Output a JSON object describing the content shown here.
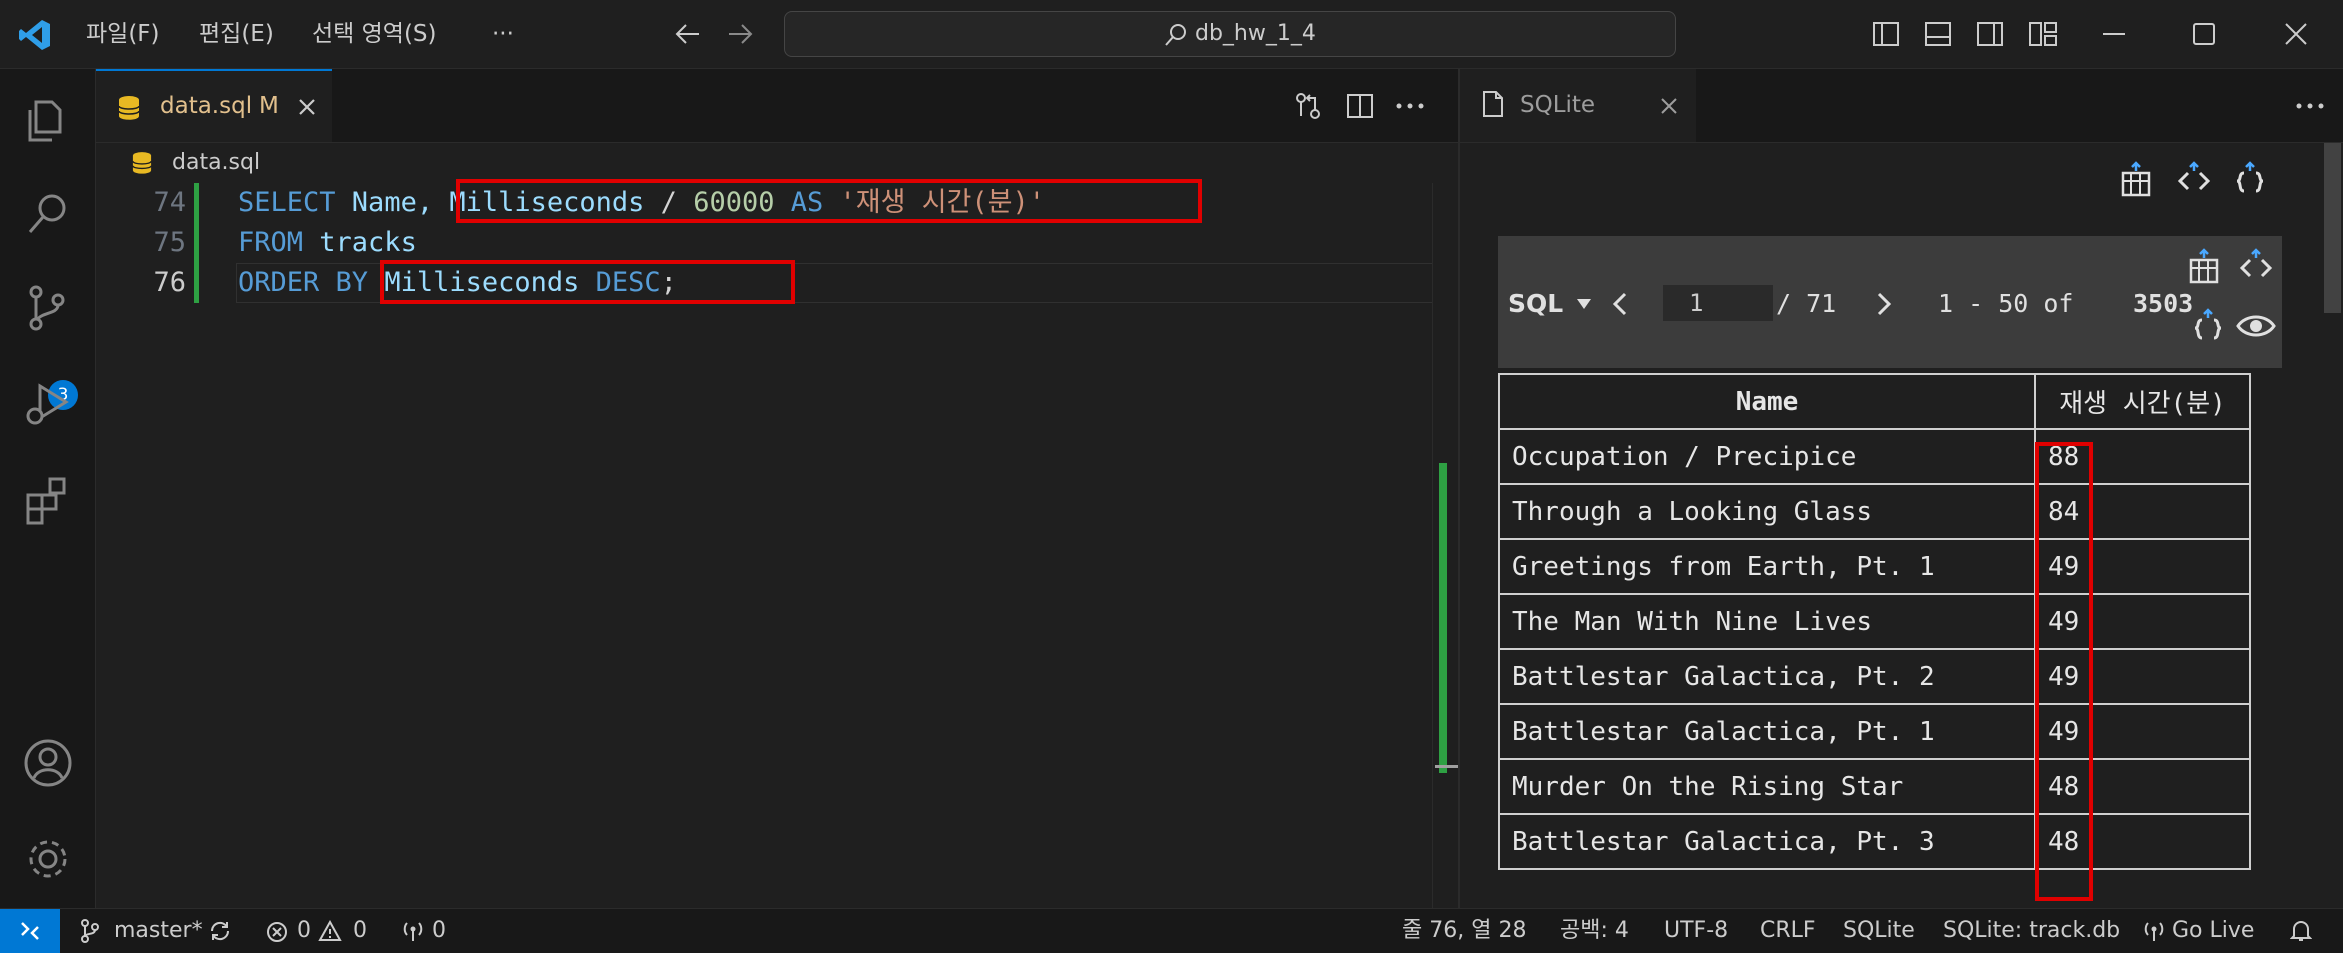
{
  "titlebar": {
    "menus": [
      "파일(F)",
      "편집(E)",
      "선택 영역(S)",
      "···"
    ],
    "search_text": "db_hw_1_4"
  },
  "activity": {
    "scm_badge": "3"
  },
  "editor": {
    "tab": {
      "name": "data.sql",
      "modified": "M"
    },
    "breadcrumb": "data.sql",
    "lines": [
      {
        "num": "74",
        "tokens": [
          "SELECT",
          " Name, ",
          "Milliseconds",
          " / ",
          "60000",
          " AS ",
          "'재생 시간(분)'"
        ]
      },
      {
        "num": "75",
        "tokens": [
          "FROM",
          " tracks"
        ]
      },
      {
        "num": "76",
        "tokens": [
          "ORDER BY",
          " ",
          "Milliseconds",
          " DESC",
          ";"
        ]
      }
    ]
  },
  "panel": {
    "tab_name": "SQLite",
    "toolbar": {
      "sql_label": "SQL",
      "page": "1",
      "total_pages": "/ 71",
      "range": "1 - 50 of",
      "total_rows": "3503"
    },
    "columns": [
      "Name",
      "재생 시간(분)"
    ],
    "rows": [
      [
        "Occupation / Precipice",
        "88"
      ],
      [
        "Through a Looking Glass",
        "84"
      ],
      [
        "Greetings from Earth, Pt. 1",
        "49"
      ],
      [
        "The Man With Nine Lives",
        "49"
      ],
      [
        "Battlestar Galactica, Pt. 2",
        "49"
      ],
      [
        "Battlestar Galactica, Pt. 1",
        "49"
      ],
      [
        "Murder On the Rising Star",
        "48"
      ],
      [
        "Battlestar Galactica, Pt. 3",
        "48"
      ]
    ]
  },
  "statusbar": {
    "branch": "master*",
    "errors": "0",
    "warnings": "0",
    "ports": "0",
    "position": "줄 76, 열 28",
    "spaces": "공백: 4",
    "encoding": "UTF-8",
    "eol": "CRLF",
    "language": "SQLite",
    "db": "SQLite: track.db",
    "golive": "Go Live"
  },
  "colors": {
    "accent": "#0078d4",
    "highlight_box": "#e00000",
    "modified": "#e2c08d"
  }
}
